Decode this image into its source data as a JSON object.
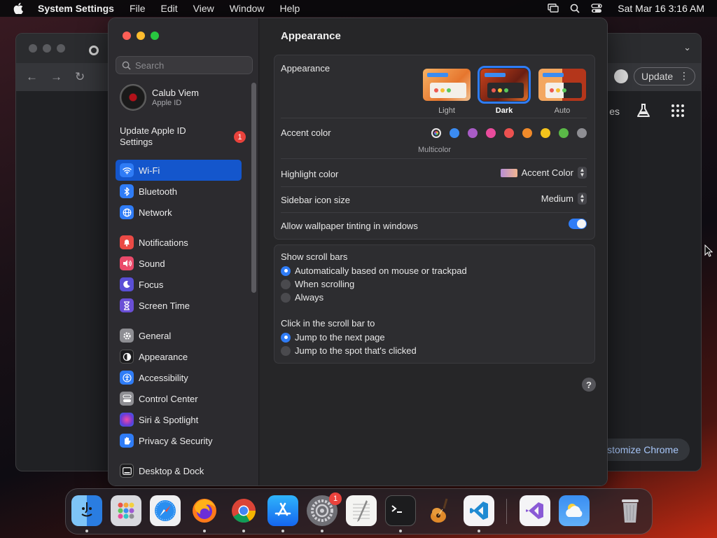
{
  "menubar": {
    "app_name": "System Settings",
    "items": [
      "File",
      "Edit",
      "View",
      "Window",
      "Help"
    ],
    "clock": "Sat Mar 16  3:16 AM"
  },
  "chrome": {
    "update_label": "Update",
    "ntp_partial_text": "es",
    "customize_label": "ustomize Chrome"
  },
  "sidebar": {
    "search_placeholder": "Search",
    "account": {
      "name": "Calub Viem",
      "subtitle": "Apple ID"
    },
    "update_prompt": {
      "label": "Update Apple ID Settings",
      "badge": "1"
    },
    "items": [
      {
        "label": "Wi-Fi",
        "icon": "wifi-icon",
        "color": "#2f7cf6",
        "selected": true
      },
      {
        "label": "Bluetooth",
        "icon": "bluetooth-icon",
        "color": "#2f7cf6"
      },
      {
        "label": "Network",
        "icon": "globe-icon",
        "color": "#2f7cf6"
      },
      {
        "label": "Notifications",
        "icon": "bell-icon",
        "color": "#ea4a45"
      },
      {
        "label": "Sound",
        "icon": "speaker-icon",
        "color": "#ea4a6a"
      },
      {
        "label": "Focus",
        "icon": "moon-icon",
        "color": "#5a4fd6"
      },
      {
        "label": "Screen Time",
        "icon": "hourglass-icon",
        "color": "#6a4fd6"
      },
      {
        "label": "General",
        "icon": "gear-icon",
        "color": "#8e8e93"
      },
      {
        "label": "Appearance",
        "icon": "appearance-icon",
        "color": "#1c1c1e"
      },
      {
        "label": "Accessibility",
        "icon": "accessibility-icon",
        "color": "#2f7cf6"
      },
      {
        "label": "Control Center",
        "icon": "control-center-icon",
        "color": "#8e8e93"
      },
      {
        "label": "Siri & Spotlight",
        "icon": "siri-icon",
        "color": "#b04ad6"
      },
      {
        "label": "Privacy & Security",
        "icon": "hand-icon",
        "color": "#2f7cf6"
      },
      {
        "label": "Desktop & Dock",
        "icon": "dock-icon",
        "color": "#1c1c1e"
      }
    ]
  },
  "main": {
    "title": "Appearance",
    "appearance": {
      "label": "Appearance",
      "options": [
        "Light",
        "Dark",
        "Auto"
      ],
      "selected": "Dark"
    },
    "accent": {
      "label": "Accent color",
      "caption": "Multicolor",
      "colors": [
        "#3b8cf2",
        "#a95cc7",
        "#e94b9c",
        "#ec5150",
        "#f08a2a",
        "#f5c41c",
        "#5ab947",
        "#8e8e93"
      ]
    },
    "highlight": {
      "label": "Highlight color",
      "value": "Accent Color"
    },
    "icon_size": {
      "label": "Sidebar icon size",
      "value": "Medium"
    },
    "tinting": {
      "label": "Allow wallpaper tinting in windows",
      "enabled": true
    },
    "scroll_bars": {
      "label": "Show scroll bars",
      "options": [
        "Automatically based on mouse or trackpad",
        "When scrolling",
        "Always"
      ],
      "selected": 0
    },
    "click_scroll": {
      "label": "Click in the scroll bar to",
      "options": [
        "Jump to the next page",
        "Jump to the spot that's clicked"
      ],
      "selected": 0
    },
    "help": "?"
  },
  "dock": {
    "apps": [
      "Finder",
      "Launchpad",
      "Safari",
      "Firefox",
      "Chrome",
      "App Store",
      "System Settings",
      "TextEdit",
      "Terminal",
      "GarageBand",
      "Visual Studio Code",
      "Visual Studio",
      "Weather",
      "Trash"
    ],
    "settings_badge": "1"
  }
}
